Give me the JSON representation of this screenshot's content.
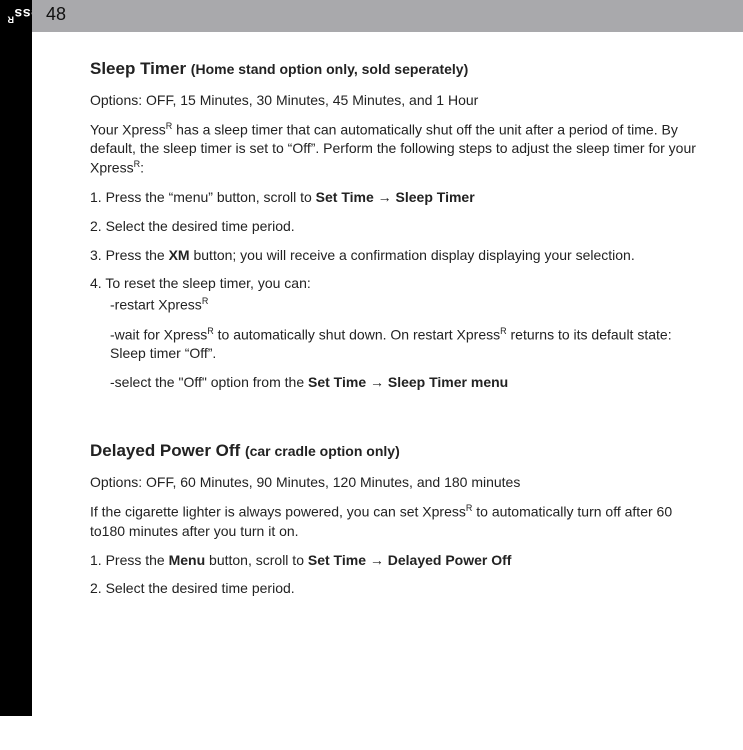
{
  "sidebar": {
    "label": "using your XpressR"
  },
  "header": {
    "page_number": "48"
  },
  "section1": {
    "title_main": "Sleep Timer ",
    "title_sub": "(Home stand option only, sold seperately)",
    "options": "Options: OFF, 15 Minutes, 30 Minutes, 45 Minutes, and 1 Hour",
    "intro_a": "Your Xpress",
    "intro_b": " has a sleep timer that can automatically shut off the unit after a period of time. By default, the sleep timer is set to “Off”. Perform the following steps to adjust the sleep timer for your Xpress",
    "intro_c": ":",
    "step1_a": "1. Press the “menu” button, scroll to ",
    "step1_b": "Set Time → Sleep Timer",
    "step2": "2. Select the desired time period.",
    "step3_a": "3. Press the ",
    "step3_b": "XM",
    "step3_c": " button; you will receive a confirmation display displaying your selection.",
    "step4_a": "4. To reset the sleep timer, you can:",
    "step4_opt1_a": "-restart Xpress",
    "step4_opt2_a": "-wait for Xpress",
    "step4_opt2_b": " to automatically shut down. On restart Xpress",
    "step4_opt2_c": " returns to its default state: Sleep timer “Off”.",
    "step4_opt3_a": "-select the \"Off\" option from the ",
    "step4_opt3_b": "Set Time → Sleep Timer menu"
  },
  "section2": {
    "title_main": "Delayed Power Off ",
    "title_sub": "(car cradle option only)",
    "options": "Options: OFF, 60 Minutes, 90 Minutes, 120 Minutes, and 180 minutes",
    "intro_a": "If the cigarette lighter is always powered, you can set Xpress",
    "intro_b": " to automatically turn off after 60 to180 minutes after you turn it on.",
    "step1_a": "1. Press the ",
    "step1_b": "Menu",
    "step1_c": " button, scroll to ",
    "step1_d": "Set Time → Delayed Power Off",
    "step2": "2. Select the desired time period."
  },
  "glyphs": {
    "r": "R"
  }
}
